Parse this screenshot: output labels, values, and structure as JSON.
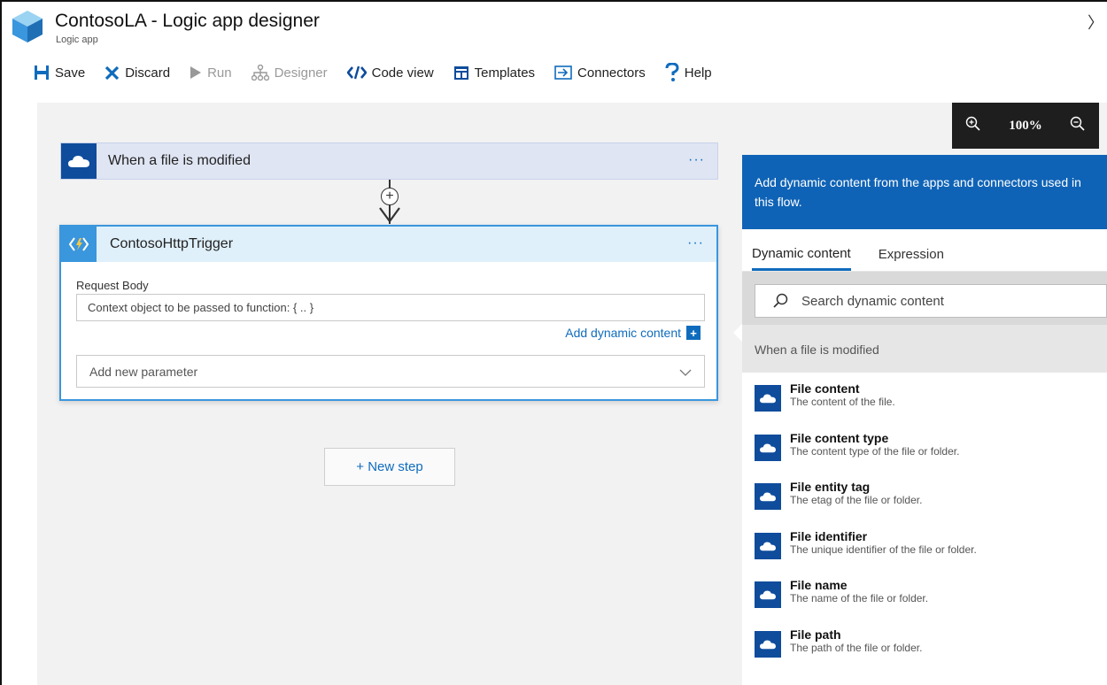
{
  "header": {
    "title": "ContosoLA - Logic app designer",
    "subtitle": "Logic app",
    "close_glyph": "〉"
  },
  "toolbar": {
    "save": "Save",
    "discard": "Discard",
    "run": "Run",
    "designer": "Designer",
    "code_view": "Code view",
    "templates": "Templates",
    "connectors": "Connectors",
    "help": "Help"
  },
  "zoom": {
    "value": "100%"
  },
  "trigger": {
    "label": "When a file is modified",
    "more": "···"
  },
  "connector": {
    "plus": "+"
  },
  "action": {
    "label": "ContosoHttpTrigger",
    "more": "···",
    "field_label": "Request Body",
    "field_value": "Context object to be passed to function: { .. }",
    "add_dynamic": "Add dynamic content",
    "param_placeholder": "Add new parameter"
  },
  "new_step": "+ New step",
  "panel": {
    "banner": "Add dynamic content from the apps and connectors used in this flow.",
    "tabs": [
      "Dynamic content",
      "Expression"
    ],
    "search_placeholder": "Search dynamic content",
    "group": "When a file is modified",
    "items": [
      {
        "name": "File content",
        "desc": "The content of the file."
      },
      {
        "name": "File content type",
        "desc": "The content type of the file or folder."
      },
      {
        "name": "File entity tag",
        "desc": "The etag of the file or folder."
      },
      {
        "name": "File identifier",
        "desc": "The unique identifier of the file or folder."
      },
      {
        "name": "File name",
        "desc": "The name of the file or folder."
      },
      {
        "name": "File path",
        "desc": "The path of the file or folder."
      }
    ]
  },
  "colors": {
    "accent": "#0f6cbd",
    "onedrive_tile": "#0f4c9c",
    "function_blue": "#3a96dd",
    "banner": "#0f63b6"
  },
  "icons": {
    "app": "logic-app-cube-icon",
    "save": "save-icon",
    "discard": "x-icon",
    "run": "play-icon",
    "designer": "designer-icon",
    "code": "code-icon",
    "templates": "templates-icon",
    "connectors": "connectors-icon",
    "help": "question-icon",
    "zoom_in": "zoom-in-icon",
    "zoom_out": "zoom-out-icon",
    "cloud": "onedrive-cloud-icon",
    "function": "azure-function-icon",
    "search": "search-icon",
    "chevron": "chevron-down-icon"
  }
}
